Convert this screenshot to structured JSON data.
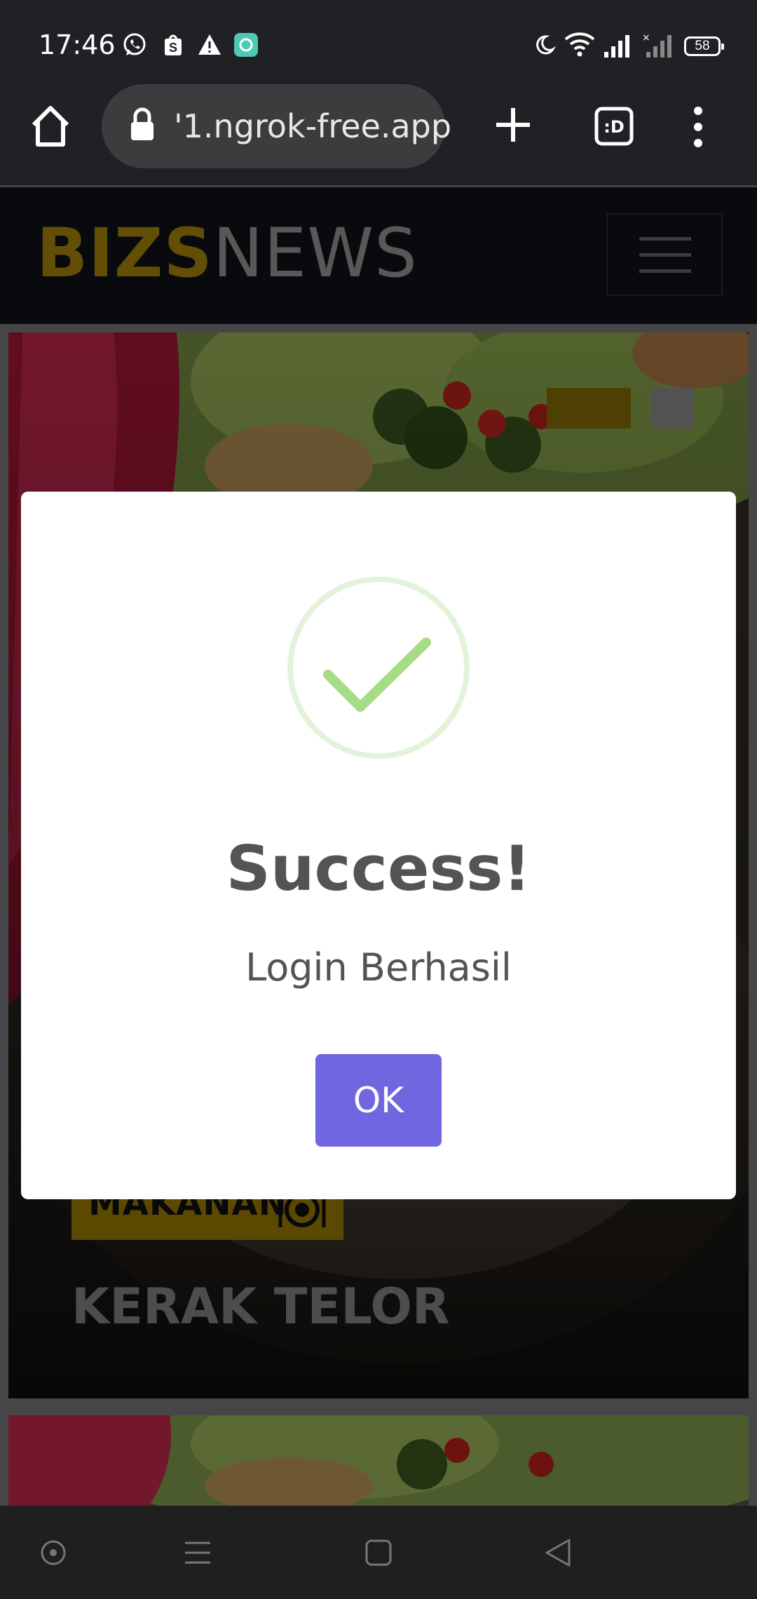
{
  "status_bar": {
    "time": "17:46",
    "battery": "58",
    "notification_icons": [
      "whatsapp-icon",
      "shopping-bag-icon",
      "warning-icon",
      "app-icon"
    ],
    "system_icons": [
      "moon-icon",
      "wifi-icon",
      "signal-icon",
      "signal-no-sim-icon",
      "battery-icon"
    ]
  },
  "browser": {
    "url": "'1.ngrok-free.app",
    "tab_count_glyph": ":D"
  },
  "site": {
    "logo_bold": "BIZS",
    "logo_light": "NEWS",
    "brand_color": "#b3900a"
  },
  "hero": {
    "category": "MAKANAN",
    "title": "KERAK TELOR"
  },
  "modal": {
    "title": "Success!",
    "message": "Login Berhasil",
    "ok_label": "OK",
    "button_color": "#7066e0",
    "success_color": "#a5dc86"
  }
}
